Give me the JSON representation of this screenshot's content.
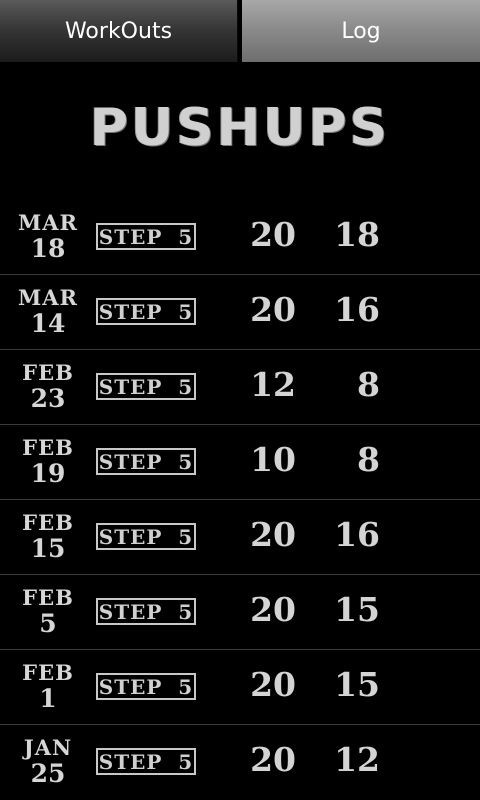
{
  "tabs": [
    {
      "label": "WorkOuts",
      "selected": false
    },
    {
      "label": "Log",
      "selected": true
    }
  ],
  "title": "PUSHUPS",
  "log": [
    {
      "month": "MAR",
      "day": "18",
      "step": "STEP  5",
      "set1": "20",
      "set2": "18"
    },
    {
      "month": "MAR",
      "day": "14",
      "step": "STEP  5",
      "set1": "20",
      "set2": "16"
    },
    {
      "month": "FEB",
      "day": "23",
      "step": "STEP  5",
      "set1": "12",
      "set2": "8"
    },
    {
      "month": "FEB",
      "day": "19",
      "step": "STEP  5",
      "set1": "10",
      "set2": "8"
    },
    {
      "month": "FEB",
      "day": "15",
      "step": "STEP  5",
      "set1": "20",
      "set2": "16"
    },
    {
      "month": "FEB",
      "day": "5",
      "step": "STEP  5",
      "set1": "20",
      "set2": "15"
    },
    {
      "month": "FEB",
      "day": "1",
      "step": "STEP  5",
      "set1": "20",
      "set2": "15"
    },
    {
      "month": "JAN",
      "day": "25",
      "step": "STEP  5",
      "set1": "20",
      "set2": "12"
    }
  ],
  "colors": {
    "background": "#000000",
    "text": "#d6d6d6",
    "divider": "#3a3a3a"
  }
}
